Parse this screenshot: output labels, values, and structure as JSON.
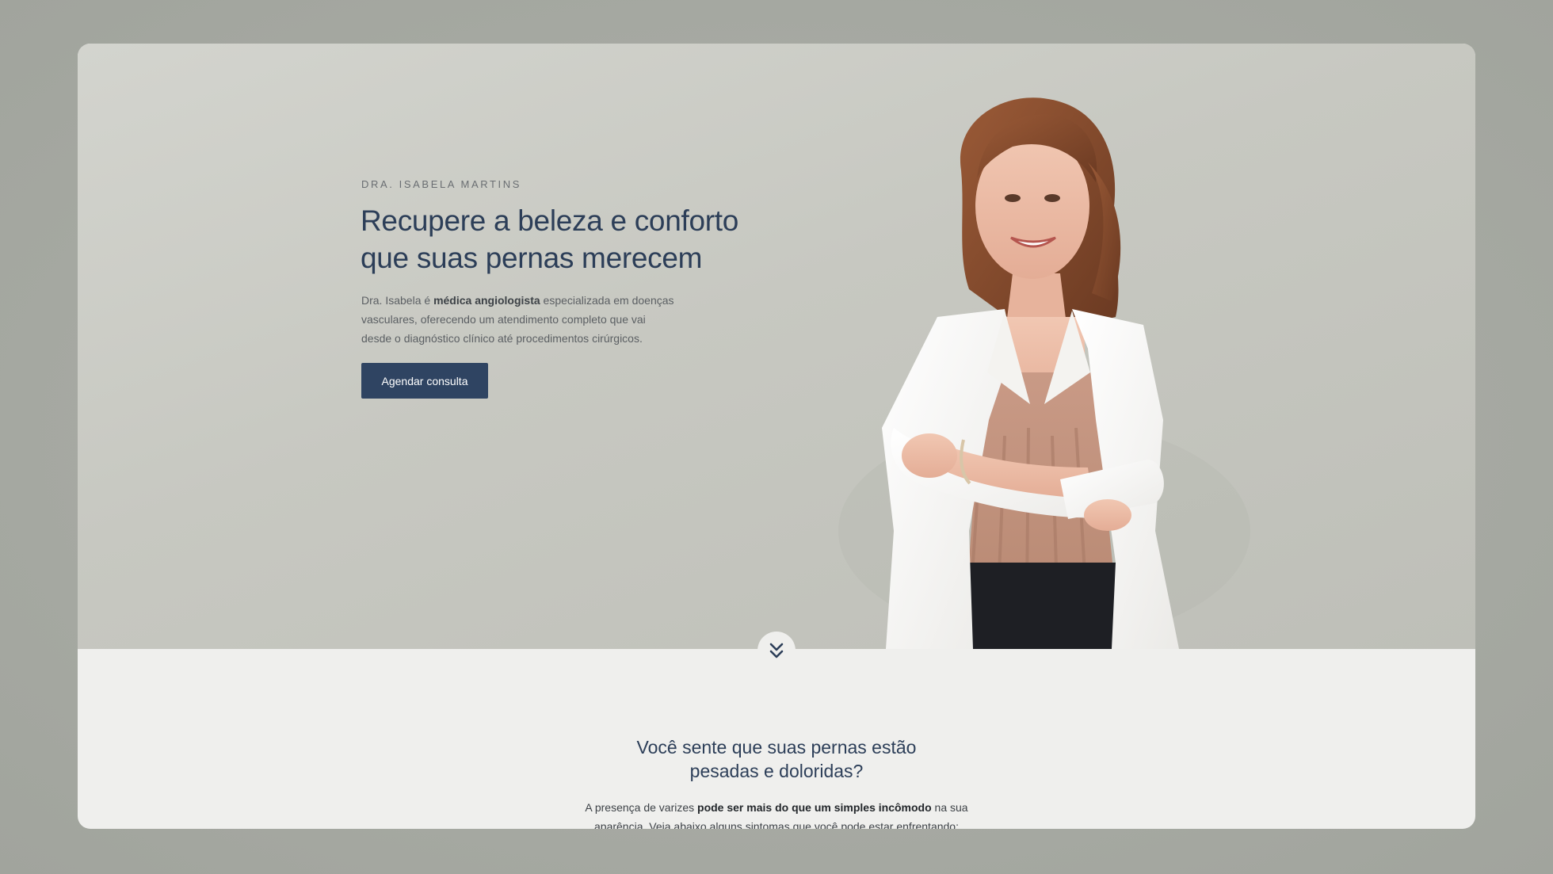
{
  "hero": {
    "eyebrow": "DRA. ISABELA MARTINS",
    "headline_line1": "Recupere a beleza e conforto",
    "headline_line2": "que suas pernas merecem",
    "desc_pre": "Dra. Isabela é ",
    "desc_bold": "médica angiologista",
    "desc_mid": " especializada em doenças",
    "desc_line2": "vasculares, oferecendo um atendimento completo que vai",
    "desc_line3": "desde o diagnóstico clínico até procedimentos cirúrgicos.",
    "cta_label": "Agendar consulta",
    "portrait_icon": "doctor-portrait"
  },
  "scroll": {
    "icon": "double-chevron-down-icon"
  },
  "symptoms": {
    "title_line1": "Você sente que suas pernas estão",
    "title_line2": "pesadas e doloridas?",
    "text_pre": "A presença de varizes ",
    "text_bold": "pode ser mais do que um simples incômodo",
    "text_post": " na sua",
    "text_line2": "aparência. Veja abaixo alguns sintomas que você pode estar enfrentando:"
  },
  "colors": {
    "accent": "#2f4462",
    "heading": "#2c3e58",
    "hero_bg": "#c9cac4",
    "section_bg": "#efefed",
    "page_bg": "#a5a8a1"
  }
}
